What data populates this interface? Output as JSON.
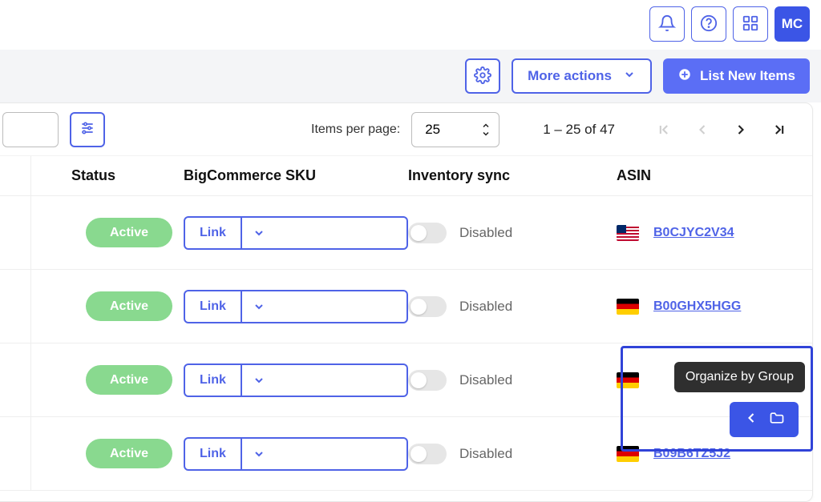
{
  "header": {
    "avatar_initials": "MC"
  },
  "action_bar": {
    "more_actions_label": "More actions",
    "list_new_label": "List New Items"
  },
  "pager": {
    "items_per_page_label": "Items per page:",
    "items_per_page_value": "25",
    "range_text": "1 – 25 of 47"
  },
  "columns": {
    "status": "Status",
    "sku": "BigCommerce SKU",
    "inventory": "Inventory sync",
    "asin": "ASIN"
  },
  "link_button_label": "Link",
  "toggle_disabled_label": "Disabled",
  "rows": [
    {
      "status": "Active",
      "flag": "us",
      "asin": "B0CJYC2V34"
    },
    {
      "status": "Active",
      "flag": "de",
      "asin": "B00GHX5HGG"
    },
    {
      "status": "Active",
      "flag": "de",
      "asin": ""
    },
    {
      "status": "Active",
      "flag": "de",
      "asin": "B09B6TZ5J2"
    }
  ],
  "organize_tooltip": "Organize by Group"
}
